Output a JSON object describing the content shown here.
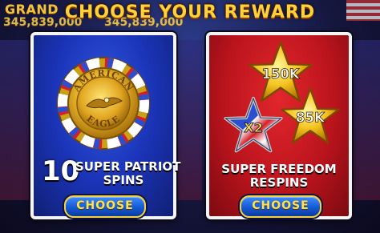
{
  "background": {
    "jackpot_label": "GRAND",
    "jackpot_value_1": "345,839,000",
    "jackpot_value_2": "345,839,000"
  },
  "title": "CHOOSE YOUR REWARD",
  "options": [
    {
      "id": "super-patriot",
      "color": "#1b34b8",
      "count": "10",
      "name_line1": "SUPER PATRIOT",
      "name_line2": "SPINS",
      "coin_text_top": "AMERICAN",
      "coin_text_bottom": "EAGLE",
      "button_label": "CHOOSE"
    },
    {
      "id": "super-freedom",
      "color": "#bb141d",
      "name_line1": "SUPER FREEDOM",
      "name_line2": "RESPINS",
      "stars": [
        "150K",
        "85K",
        "X2"
      ],
      "button_label": "CHOOSE"
    }
  ],
  "colors": {
    "gold": "#ffd23b",
    "button_blue": "#1459d6",
    "panel_border": "#f4f4f4"
  }
}
